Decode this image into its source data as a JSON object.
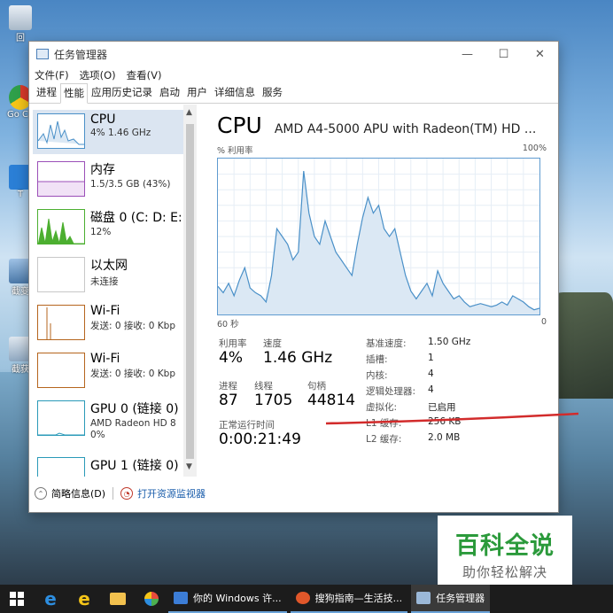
{
  "desktop": {
    "icons": [
      {
        "label": "回"
      },
      {
        "label": "Go Chr"
      },
      {
        "label": "T"
      },
      {
        "label": "截变"
      },
      {
        "label": "截获"
      }
    ]
  },
  "window": {
    "title": "任务管理器",
    "menu": [
      "文件(F)",
      "选项(O)",
      "查看(V)"
    ],
    "tabs": [
      "进程",
      "性能",
      "应用历史记录",
      "启动",
      "用户",
      "详细信息",
      "服务"
    ],
    "active_tab": "性能"
  },
  "resources": [
    {
      "name": "CPU",
      "sub": "4% 1.46 GHz"
    },
    {
      "name": "内存",
      "sub": "1.5/3.5 GB (43%)"
    },
    {
      "name": "磁盘 0 (C: D: E:",
      "sub": "12%"
    },
    {
      "name": "以太网",
      "sub": "未连接"
    },
    {
      "name": "Wi-Fi",
      "sub": "发送: 0 接收: 0 Kbp"
    },
    {
      "name": "Wi-Fi",
      "sub": "发送: 0 接收: 0 Kbp"
    },
    {
      "name": "GPU 0 (链接 0)",
      "sub": "AMD Radeon HD 8",
      "sub2": "0%"
    },
    {
      "name": "GPU 1 (链接 0)",
      "sub": ""
    }
  ],
  "cpu": {
    "title": "CPU",
    "model": "AMD A4-5000 APU with Radeon(TM) HD ...",
    "graph_label": "% 利用率",
    "graph_max": "100%",
    "graph_time": "60 秒",
    "graph_min": "0",
    "utilization_label": "利用率",
    "utilization": "4%",
    "speed_label": "速度",
    "speed": "1.46 GHz",
    "processes_label": "进程",
    "processes": "87",
    "threads_label": "线程",
    "threads": "1705",
    "handles_label": "句柄",
    "handles": "44814",
    "uptime_label": "正常运行时间",
    "uptime": "0:00:21:49",
    "details": [
      {
        "label": "基准速度:",
        "value": "1.50 GHz"
      },
      {
        "label": "插槽:",
        "value": "1"
      },
      {
        "label": "内核:",
        "value": "4"
      },
      {
        "label": "逻辑处理器:",
        "value": "4"
      },
      {
        "label": "虚拟化:",
        "value": "已启用"
      },
      {
        "label": "L1 缓存:",
        "value": "256 KB"
      },
      {
        "label": "L2 缓存:",
        "value": "2.0 MB"
      }
    ]
  },
  "chart_data": {
    "type": "area",
    "title": "",
    "xlabel": "60 秒",
    "ylabel": "% 利用率",
    "ylim": [
      0,
      100
    ],
    "xlim": [
      60,
      0
    ],
    "x": [
      60,
      59,
      58,
      57,
      56,
      55,
      54,
      53,
      52,
      51,
      50,
      49,
      48,
      47,
      46,
      45,
      44,
      43,
      42,
      41,
      40,
      39,
      38,
      37,
      36,
      35,
      34,
      33,
      32,
      31,
      30,
      29,
      28,
      27,
      26,
      25,
      24,
      23,
      22,
      21,
      20,
      19,
      18,
      17,
      16,
      15,
      14,
      13,
      12,
      11,
      10,
      9,
      8,
      7,
      6,
      5,
      4,
      3,
      2,
      1,
      0
    ],
    "values": [
      18,
      14,
      20,
      12,
      22,
      30,
      17,
      14,
      12,
      8,
      25,
      55,
      50,
      45,
      35,
      40,
      92,
      65,
      50,
      45,
      60,
      50,
      40,
      35,
      30,
      25,
      45,
      62,
      75,
      65,
      70,
      55,
      50,
      55,
      40,
      25,
      15,
      10,
      15,
      20,
      12,
      28,
      20,
      15,
      10,
      12,
      8,
      5,
      6,
      7,
      6,
      5,
      6,
      8,
      6,
      12,
      10,
      8,
      5,
      3,
      4
    ],
    "grid": true,
    "color": "#4a90c8",
    "fill": "#dbe8f4"
  },
  "footer": {
    "summary": "简略信息(D)",
    "monitor": "打开资源监视器"
  },
  "watermark": {
    "big": "百科全说",
    "small": "助你轻松解决"
  },
  "taskbar": {
    "apps": [
      {
        "label": "你的 Windows 许...",
        "color": "#3c7dd6"
      },
      {
        "label": "搜狗指南—生活技...",
        "color": "#e0572a"
      },
      {
        "label": "任务管理器",
        "color": "#9bb8d8"
      }
    ]
  },
  "colors": {
    "cpu": "#4a90c8",
    "memory": "#9b4fb8",
    "disk": "#4caf30",
    "wifi": "#b5651d",
    "gpu": "#2a9ab8"
  }
}
